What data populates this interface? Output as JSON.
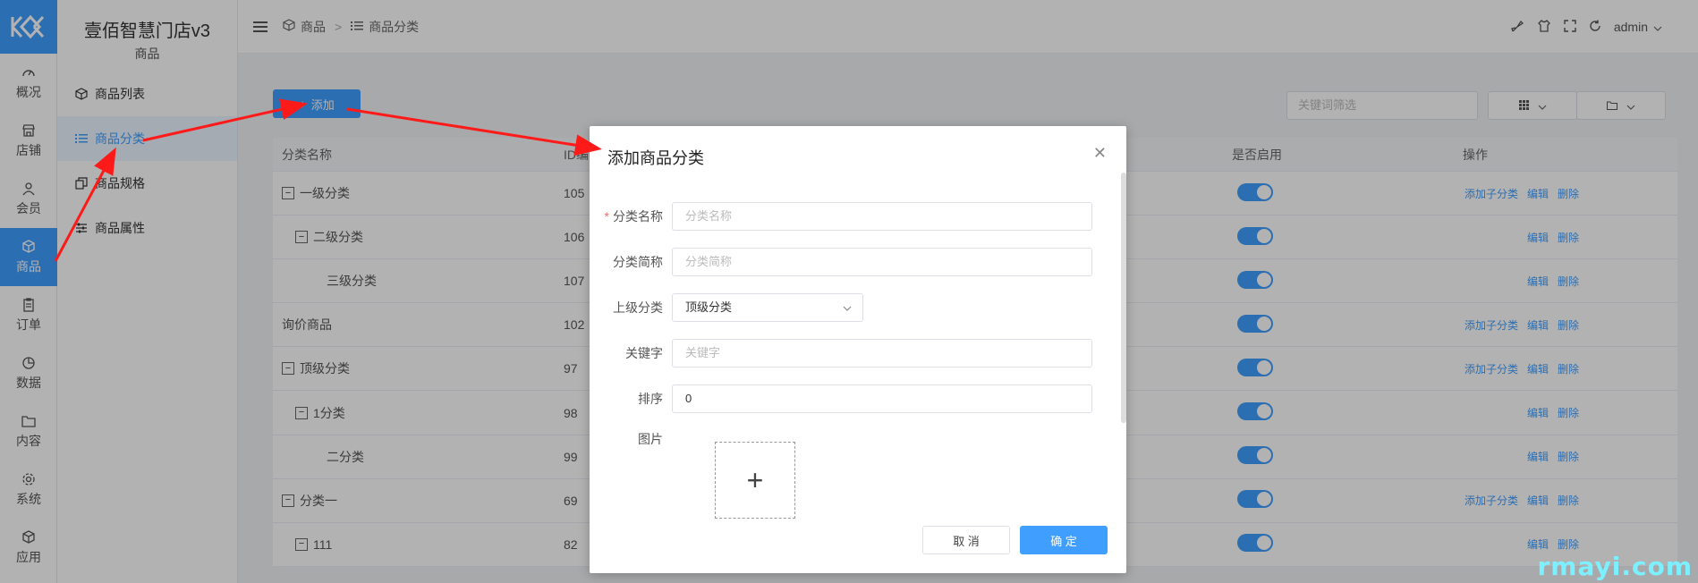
{
  "app": {
    "title": "壹佰智慧门店v3",
    "section": "商品"
  },
  "rail": {
    "items": [
      {
        "label": "概况",
        "icon": "dashboard-icon"
      },
      {
        "label": "店铺",
        "icon": "store-icon"
      },
      {
        "label": "会员",
        "icon": "user-icon"
      },
      {
        "label": "商品",
        "icon": "box-icon",
        "active": true
      },
      {
        "label": "订单",
        "icon": "order-icon"
      },
      {
        "label": "数据",
        "icon": "chart-icon"
      },
      {
        "label": "内容",
        "icon": "folder-icon"
      },
      {
        "label": "系统",
        "icon": "gear-icon"
      },
      {
        "label": "应用",
        "icon": "app-icon"
      }
    ]
  },
  "menu": {
    "items": [
      {
        "label": "商品列表",
        "icon": "cube-icon"
      },
      {
        "label": "商品分类",
        "icon": "list-icon",
        "active": true
      },
      {
        "label": "商品规格",
        "icon": "copy-icon"
      },
      {
        "label": "商品属性",
        "icon": "sliders-icon"
      }
    ]
  },
  "header": {
    "breadcrumb": [
      "商品",
      "商品分类"
    ],
    "separator": ">",
    "user": "admin"
  },
  "toolbar": {
    "add_label": "添加",
    "filter_placeholder": "关键词筛选"
  },
  "table": {
    "columns": {
      "name": "分类名称",
      "id": "ID编",
      "enabled": "是否启用",
      "actions": "操作"
    },
    "rows": [
      {
        "name": "一级分类",
        "id": "105",
        "level": 0,
        "collapsible": true,
        "actions": [
          "添加子分类",
          "编辑",
          "删除"
        ]
      },
      {
        "name": "二级分类",
        "id": "106",
        "level": 1,
        "collapsible": true,
        "actions": [
          "编辑",
          "删除"
        ]
      },
      {
        "name": "三级分类",
        "id": "107",
        "level": 2,
        "collapsible": false,
        "actions": [
          "编辑",
          "删除"
        ]
      },
      {
        "name": "询价商品",
        "id": "102",
        "level": 0,
        "collapsible": false,
        "actions": [
          "添加子分类",
          "编辑",
          "删除"
        ]
      },
      {
        "name": "顶级分类",
        "id": "97",
        "level": 0,
        "collapsible": true,
        "actions": [
          "添加子分类",
          "编辑",
          "删除"
        ]
      },
      {
        "name": "1分类",
        "id": "98",
        "level": 1,
        "collapsible": true,
        "actions": [
          "编辑",
          "删除"
        ]
      },
      {
        "name": "二分类",
        "id": "99",
        "level": 2,
        "collapsible": false,
        "actions": [
          "编辑",
          "删除"
        ]
      },
      {
        "name": "分类一",
        "id": "69",
        "level": 0,
        "collapsible": true,
        "actions": [
          "添加子分类",
          "编辑",
          "删除"
        ]
      },
      {
        "name": "111",
        "id": "82",
        "level": 1,
        "collapsible": true,
        "actions": [
          "编辑",
          "删除"
        ]
      }
    ]
  },
  "dialog": {
    "title": "添加商品分类",
    "fields": {
      "name_label": "分类名称",
      "name_placeholder": "分类名称",
      "short_label": "分类简称",
      "short_placeholder": "分类简称",
      "parent_label": "上级分类",
      "parent_value": "顶级分类",
      "keyword_label": "关键字",
      "keyword_placeholder": "关键字",
      "sort_label": "排序",
      "sort_value": "0",
      "image_label": "图片"
    },
    "cancel_label": "取 消",
    "ok_label": "确 定"
  },
  "watermark": "rmayi.com",
  "colors": {
    "primary": "#409eff",
    "arrow": "#ff1a1a"
  }
}
